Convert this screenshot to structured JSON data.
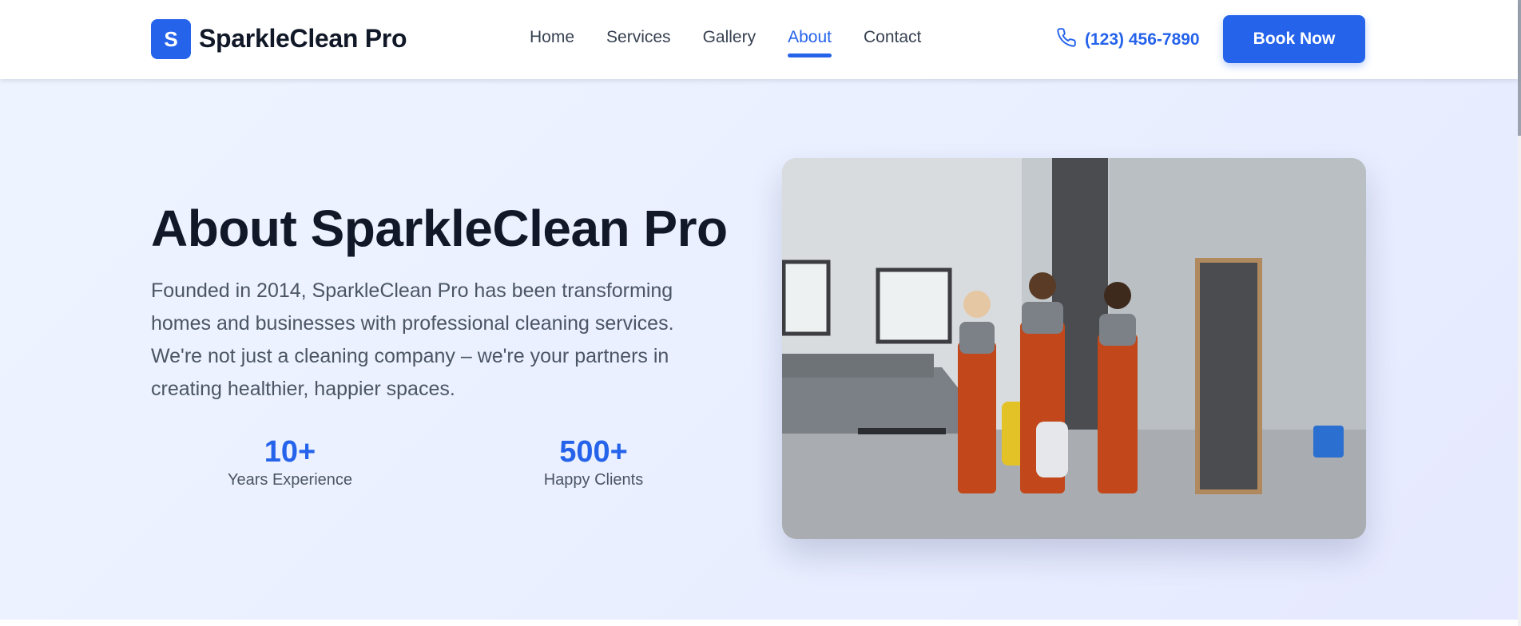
{
  "header": {
    "logo_letter": "S",
    "brand_name": "SparkleClean Pro",
    "nav": [
      {
        "label": "Home"
      },
      {
        "label": "Services"
      },
      {
        "label": "Gallery"
      },
      {
        "label": "About",
        "active": true
      },
      {
        "label": "Contact"
      }
    ],
    "phone": "(123) 456-7890",
    "phone_icon": "phone-icon",
    "cta_label": "Book Now"
  },
  "hero": {
    "title": "About SparkleClean Pro",
    "description": "Founded in 2014, SparkleClean Pro has been transforming homes and businesses with professional cleaning services. We're not just a cleaning company – we're your partners in creating healthier, happier spaces.",
    "stats": [
      {
        "value": "10+",
        "label": "Years Experience"
      },
      {
        "value": "500+",
        "label": "Happy Clients"
      }
    ]
  },
  "colors": {
    "accent": "#2563eb",
    "heading": "#111827",
    "body_text": "#4b5563",
    "hero_bg": "#eaf0ff"
  }
}
